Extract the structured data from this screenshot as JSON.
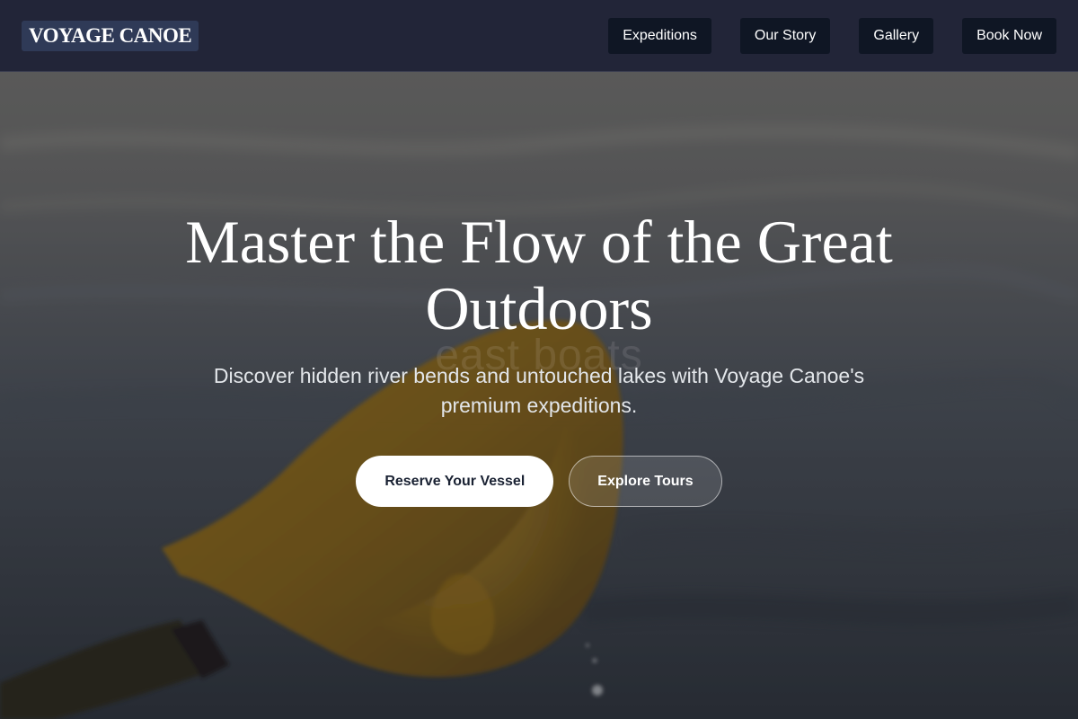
{
  "header": {
    "logo": "VOYAGE CANOE",
    "nav": [
      {
        "label": "Expeditions"
      },
      {
        "label": "Our Story"
      },
      {
        "label": "Gallery"
      },
      {
        "label": "Book Now"
      }
    ]
  },
  "hero": {
    "headline": "Master the Flow of the Great Outdoors",
    "subhead": "Discover hidden river bends and untouched lakes with Voyage Canoe's premium expeditions.",
    "watermark": "east boats",
    "primary_cta": "Reserve Your Vessel",
    "secondary_cta": "Explore Tours"
  },
  "colors": {
    "nav_bg": "#222538",
    "nav_button_bg": "#0f1624",
    "paddle": "#b88a1c",
    "water": "#5e636b"
  }
}
